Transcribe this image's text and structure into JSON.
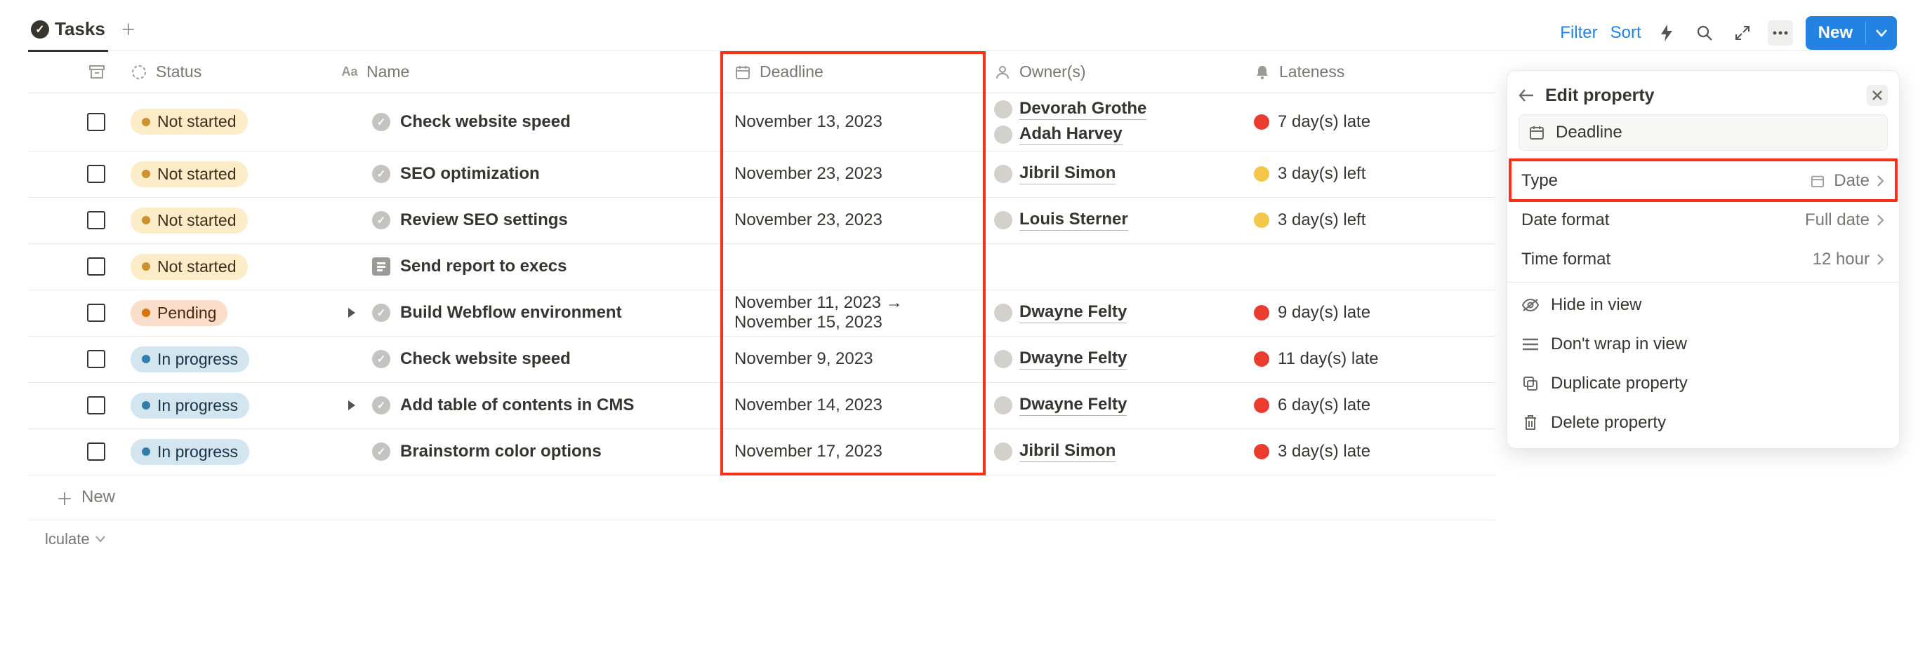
{
  "tab": {
    "label": "Tasks"
  },
  "actions": {
    "filter": "Filter",
    "sort": "Sort",
    "new": "New"
  },
  "columns": {
    "status": "Status",
    "name": "Name",
    "deadline": "Deadline",
    "owners": "Owner(s)",
    "lateness": "Lateness"
  },
  "statuses": {
    "not_started": "Not started",
    "pending": "Pending",
    "in_progress": "In progress"
  },
  "rows": [
    {
      "status": "not_started",
      "name": "Check website speed",
      "deadline": "November 13, 2023",
      "owners": [
        "Devorah Grothe",
        "Adah Harvey"
      ],
      "late_text": "7 day(s) late",
      "late_color": "red"
    },
    {
      "status": "not_started",
      "name": "SEO optimization",
      "deadline": "November 23, 2023",
      "owners": [
        "Jibril Simon"
      ],
      "late_text": "3 day(s) left",
      "late_color": "yellow"
    },
    {
      "status": "not_started",
      "name": "Review SEO settings",
      "deadline": "November 23, 2023",
      "owners": [
        "Louis Sterner"
      ],
      "late_text": "3 day(s) left",
      "late_color": "yellow"
    },
    {
      "status": "not_started",
      "name": "Send report to execs",
      "deadline": "",
      "owners": [],
      "late_text": "",
      "late_color": "",
      "template": true
    },
    {
      "status": "pending",
      "name": "Build Webflow environment",
      "deadline": "November 11, 2023 → November 15, 2023",
      "owners": [
        "Dwayne Felty"
      ],
      "late_text": "9 day(s) late",
      "late_color": "red",
      "expandable": true
    },
    {
      "status": "in_progress",
      "name": "Check website speed",
      "deadline": "November 9, 2023",
      "owners": [
        "Dwayne Felty"
      ],
      "late_text": "11 day(s) late",
      "late_color": "red"
    },
    {
      "status": "in_progress",
      "name": "Add table of contents in CMS",
      "deadline": "November 14, 2023",
      "owners": [
        "Dwayne Felty"
      ],
      "late_text": "6 day(s) late",
      "late_color": "red",
      "expandable": true
    },
    {
      "status": "in_progress",
      "name": "Brainstorm color options",
      "deadline": "November 17, 2023",
      "owners": [
        "Jibril Simon"
      ],
      "late_text": "3 day(s) late",
      "late_color": "red"
    }
  ],
  "new_row": "New",
  "footer_select": "lculate",
  "panel": {
    "title": "Edit property",
    "property_name": "Deadline",
    "rows": {
      "type": {
        "label": "Type",
        "value": "Date"
      },
      "date_format": {
        "label": "Date format",
        "value": "Full date"
      },
      "time_format": {
        "label": "Time format",
        "value": "12 hour"
      }
    },
    "actions": {
      "hide": "Hide in view",
      "nowrap": "Don't wrap in view",
      "duplicate": "Duplicate property",
      "delete": "Delete property"
    }
  },
  "status_class": {
    "not_started": "pill-notstarted",
    "pending": "pill-pending",
    "in_progress": "pill-inprogress"
  }
}
